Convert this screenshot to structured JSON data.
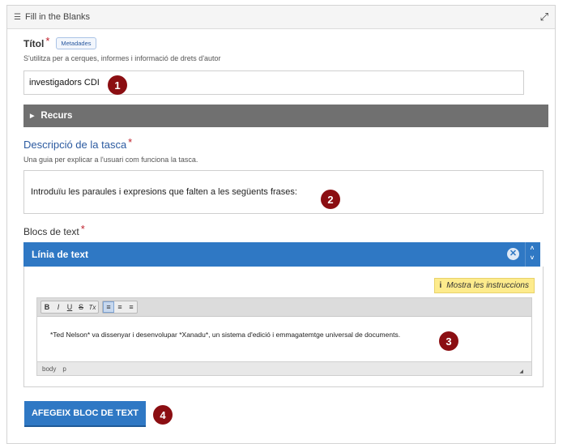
{
  "window": {
    "title": "Fill in the Blanks"
  },
  "title_field": {
    "label": "Títol",
    "required_mark": "*",
    "tag": "Metadades",
    "help": "S'utilitza per a cerques, informes i informació de drets d'autor",
    "value": "investigadors CDI"
  },
  "resource": {
    "label": "Recurs"
  },
  "task_description": {
    "label": "Descripció de la tasca",
    "required_mark": "*",
    "help": "Una guia per explicar a l'usuari com funciona la tasca.",
    "value": "Introduïu les paraules i expresions que falten a les següents frases:"
  },
  "text_blocks": {
    "label": "Blocs de text",
    "required_mark": "*",
    "block_header": "Línia de text",
    "instructions_button": "Mostra les instruccions",
    "editor": {
      "toolbar": [
        "B",
        "I",
        "U",
        "S",
        "Tx"
      ],
      "align": [
        "≡",
        "≡",
        "≡"
      ],
      "text": "*Ted Nelson* va dissenyar i desenvolupar *Xanadu*, un sistema d'edició i emmagatemtge universal de documents.",
      "status_path": [
        "body",
        "p"
      ]
    },
    "add_button": "AFEGEIX BLOC DE TEXT"
  },
  "badges": [
    "1",
    "2",
    "3",
    "4"
  ],
  "colors": {
    "accent_blue": "#2f78c4",
    "badge": "#8b0e12",
    "required": "#c0212d",
    "instructions_bg": "#fdeb8c"
  },
  "icons": {
    "header": "list-icon",
    "expand": "expand-icon",
    "remove": "close-circle-icon"
  }
}
